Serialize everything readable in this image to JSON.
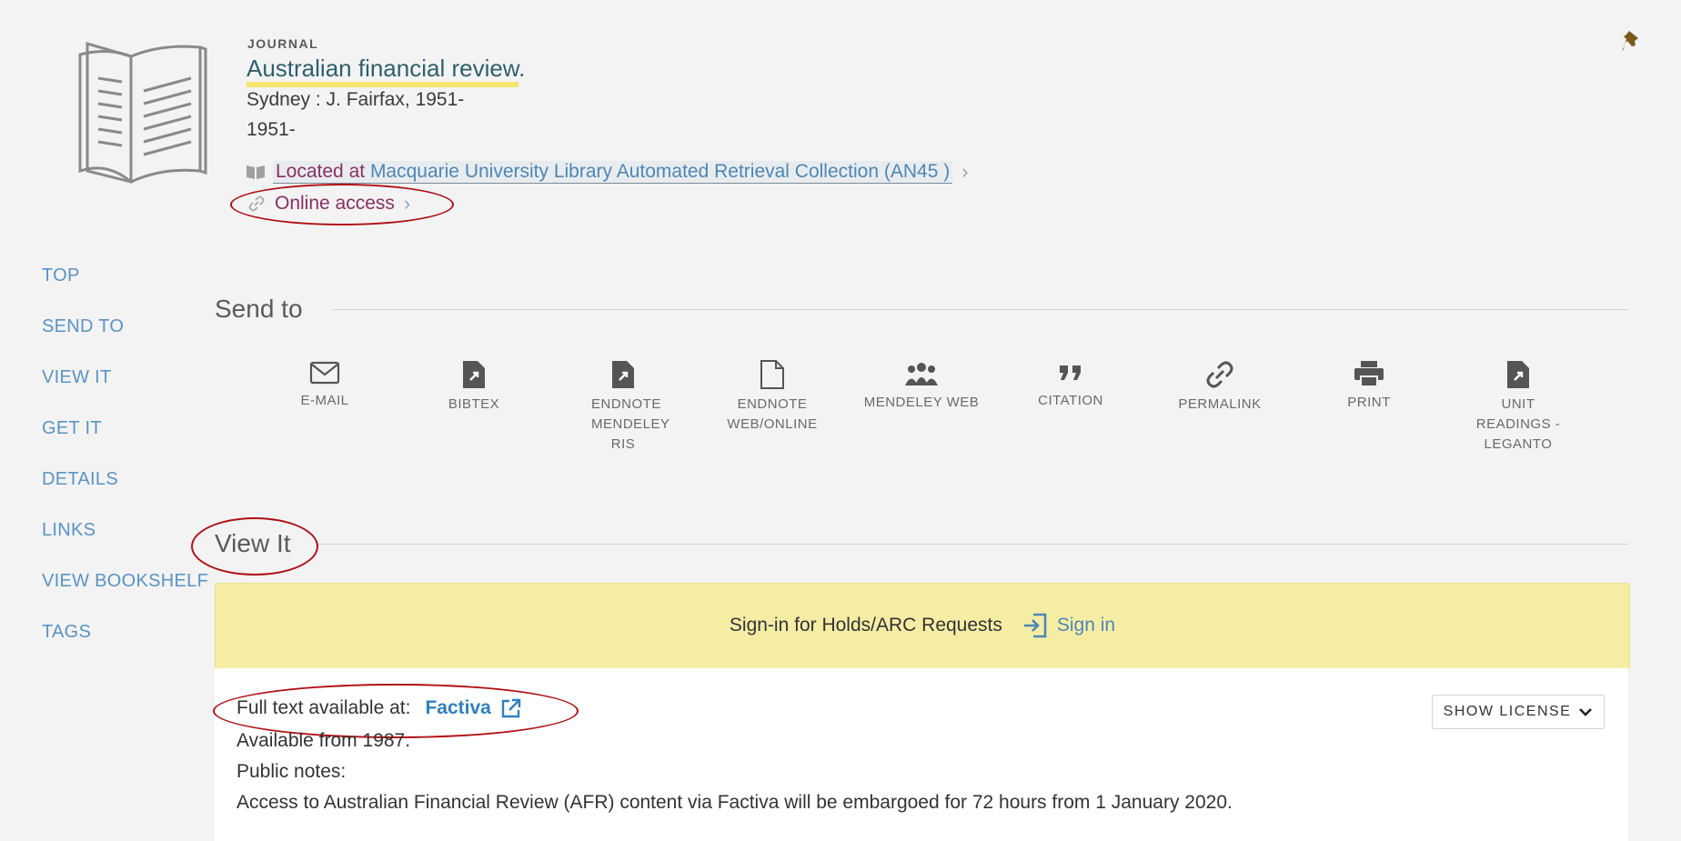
{
  "record": {
    "type_label": "JOURNAL",
    "title": "Australian financial review",
    "title_period": ".",
    "publisher": "Sydney : J. Fairfax, 1951-",
    "date": "1951-",
    "location_prefix": "Located at",
    "location_link": "Macquarie University Library  Automated Retrieval Collection (AN45 )",
    "online_access": "Online access"
  },
  "nav": {
    "items": [
      {
        "label": "TOP"
      },
      {
        "label": "SEND TO"
      },
      {
        "label": "VIEW IT"
      },
      {
        "label": "GET IT"
      },
      {
        "label": "DETAILS"
      },
      {
        "label": "LINKS"
      },
      {
        "label": "VIEW BOOKSHELF"
      },
      {
        "label": "TAGS"
      }
    ]
  },
  "send_to": {
    "title": "Send to",
    "items": [
      {
        "label": "E-MAIL",
        "icon": "mail-icon"
      },
      {
        "label": "BIBTEX",
        "icon": "file-export-icon"
      },
      {
        "label": "ENDNOTE MENDELEY RIS",
        "icon": "file-export-icon"
      },
      {
        "label": "ENDNOTE WEB/ONLINE",
        "icon": "document-icon"
      },
      {
        "label": "MENDELEY WEB",
        "icon": "people-icon"
      },
      {
        "label": "CITATION",
        "icon": "quote-icon"
      },
      {
        "label": "PERMALINK",
        "icon": "link-icon"
      },
      {
        "label": "PRINT",
        "icon": "print-icon"
      },
      {
        "label": "UNIT READINGS - LEGANTO",
        "icon": "file-export-icon"
      }
    ]
  },
  "view_it": {
    "title": "View It",
    "signin_text": "Sign-in for Holds/ARC Requests",
    "signin_link": "Sign in",
    "fulltext_label": "Full text available at:",
    "fulltext_link": "Factiva",
    "available_from": "Available from 1987.",
    "public_notes_label": "Public notes:",
    "public_note": "Access to Australian Financial Review (AFR) content via Factiva will be embargoed for 72 hours from 1 January 2020.",
    "show_license": "SHOW LICENSE"
  },
  "colors": {
    "accent_link": "#4e86b6",
    "signin_bg": "#f6eda5",
    "annotation_red": "#b00f14",
    "title_highlight": "#f6e46d"
  }
}
